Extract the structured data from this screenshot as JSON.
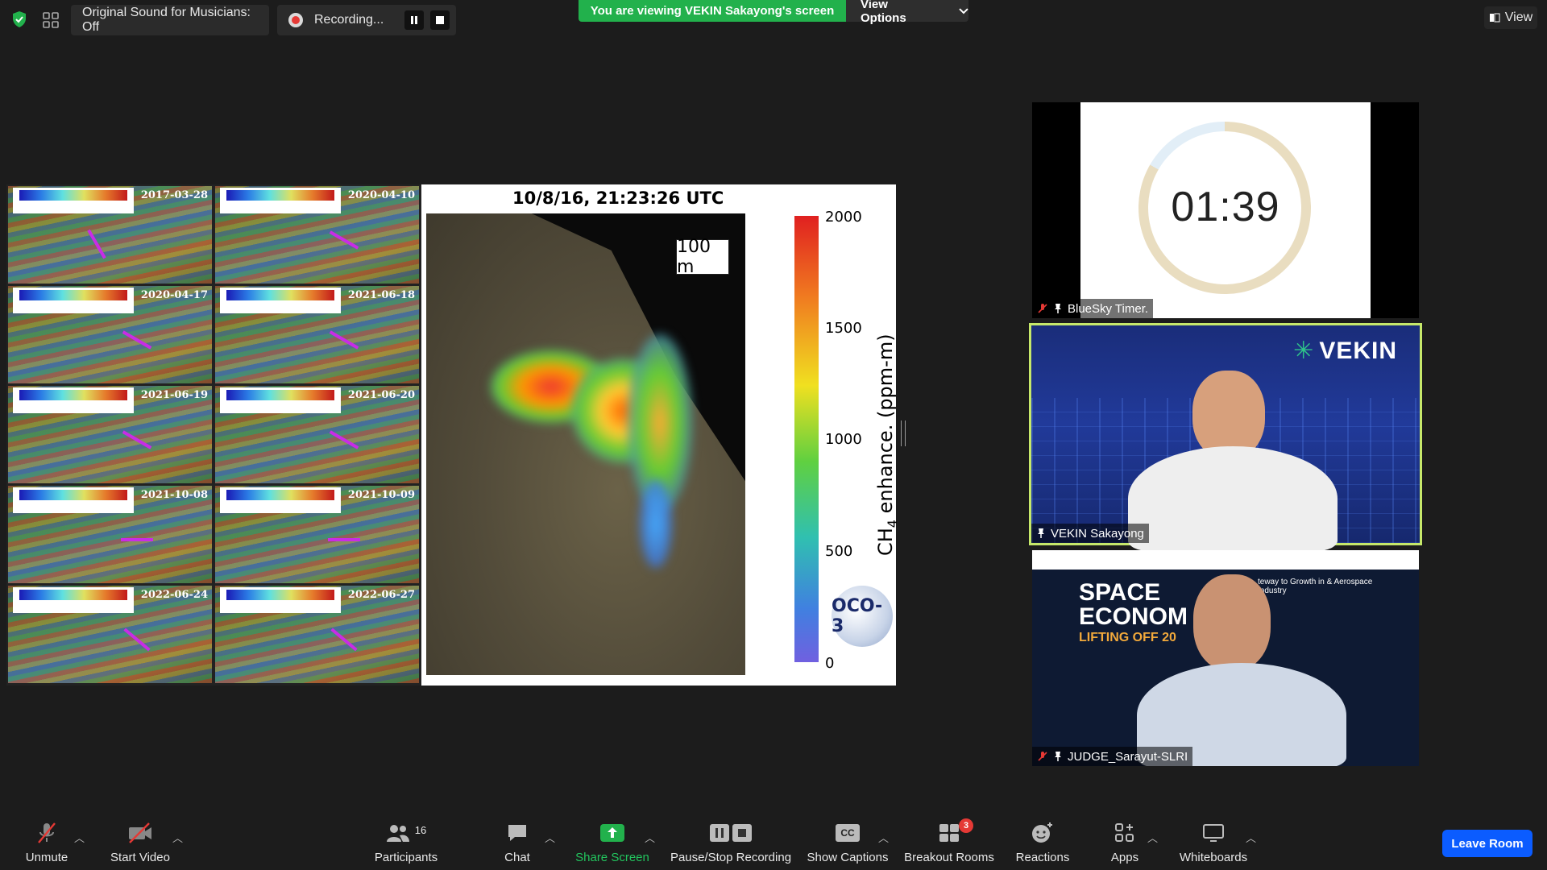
{
  "top_bar": {
    "sound_label": "Original Sound for Musicians: Off",
    "recording_label": "Recording...",
    "viewing_banner": "You are viewing VEKIN Sakayong's screen",
    "view_options_label": "View Options",
    "view_label": "View"
  },
  "shared_screen": {
    "tiles": [
      {
        "date": "2017-03-28"
      },
      {
        "date": "2020-04-10"
      },
      {
        "date": "2020-04-17"
      },
      {
        "date": "2021-06-18"
      },
      {
        "date": "2021-06-19"
      },
      {
        "date": "2021-06-20"
      },
      {
        "date": "2021-10-08"
      },
      {
        "date": "2021-10-09"
      },
      {
        "date": "2022-06-24"
      },
      {
        "date": "2022-06-27"
      }
    ],
    "map_title": "10/8/16, 21:23:26 UTC",
    "scale_label": "100 m",
    "colorbar_ticks": [
      "2000",
      "1500",
      "1000",
      "500",
      "0"
    ],
    "colorbar_label": "CH",
    "colorbar_label_sub": "4",
    "colorbar_label_rest": " enhance. (ppm-m)",
    "logo_text": "OCO-3"
  },
  "gallery": {
    "timer": {
      "value": "01:39",
      "name": "BlueSky Timer."
    },
    "presenter": {
      "name": "VEKIN Sakayong",
      "logo": "VEKIN"
    },
    "judge": {
      "name": "JUDGE_Sarayut-SLRI",
      "banner_line1": "SPACE",
      "banner_line2": "ECONOM",
      "banner_line3": "LIFTING OFF 20",
      "banner_side": "teway to Growth in & Aerospace Industry"
    }
  },
  "toolbar": {
    "unmute": "Unmute",
    "start_video": "Start Video",
    "participants": "Participants",
    "participants_count": "16",
    "chat": "Chat",
    "share_screen": "Share Screen",
    "pause_stop": "Pause/Stop Recording",
    "captions": "Show Captions",
    "captions_icon": "CC",
    "breakout": "Breakout Rooms",
    "breakout_badge": "3",
    "reactions": "Reactions",
    "apps": "Apps",
    "whiteboards": "Whiteboards",
    "leave": "Leave Room"
  },
  "colors": {
    "banner_green": "#22b14c",
    "leave_blue": "#0b5cff",
    "active_speaker_border": "#c6e86a",
    "share_green": "#22b14c"
  }
}
